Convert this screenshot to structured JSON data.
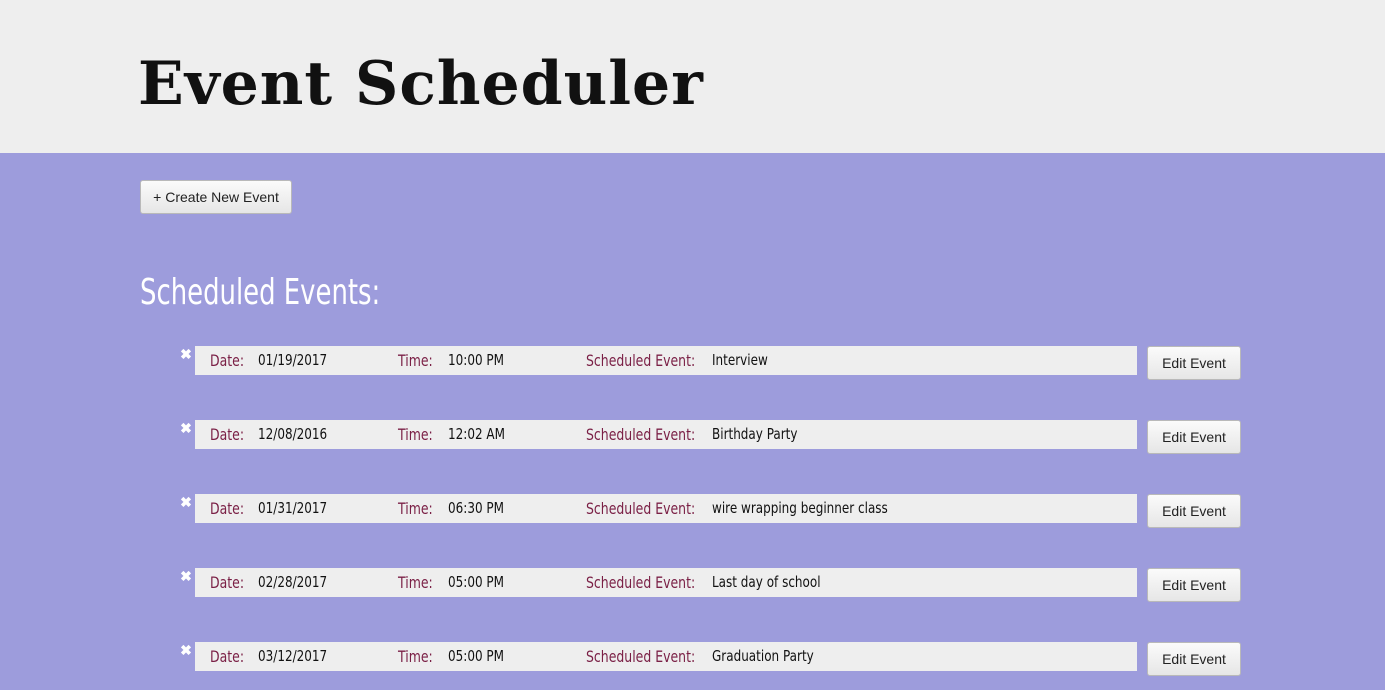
{
  "header": {
    "title": "Event Scheduler"
  },
  "toolbar": {
    "create_label": "+ Create New Event"
  },
  "events_section": {
    "title": "Scheduled Events:",
    "date_label": "Date:",
    "time_label": "Time:",
    "event_label": "Scheduled Event:",
    "edit_label": "Edit Event",
    "delete_glyph": "✖"
  },
  "events": [
    {
      "date": "01/19/2017",
      "time": "10:00 PM",
      "name": "Interview"
    },
    {
      "date": "12/08/2016",
      "time": "12:02 AM",
      "name": "Birthday Party"
    },
    {
      "date": "01/31/2017",
      "time": "06:30 PM",
      "name": "wire wrapping beginner class"
    },
    {
      "date": "02/28/2017",
      "time": "05:00 PM",
      "name": "Last day of school"
    },
    {
      "date": "03/12/2017",
      "time": "05:00 PM",
      "name": "Graduation Party"
    }
  ],
  "colors": {
    "header_background": "#eeeeee",
    "main_background": "#9d9cdc",
    "label_color": "#7a1f45",
    "row_background": "#eeeeee"
  }
}
